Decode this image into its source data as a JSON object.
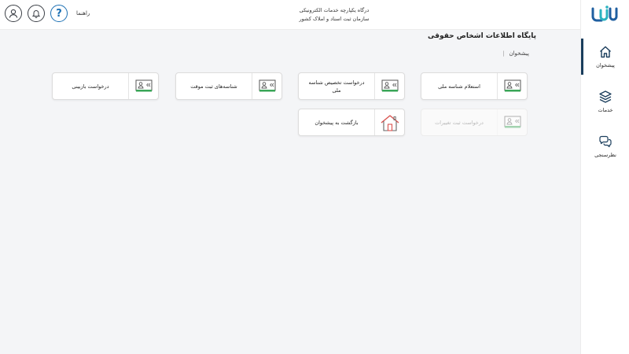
{
  "header": {
    "help_label": "راهنما",
    "help_glyph": "?",
    "gov_title_line1": "درگاه یکپارچه خدمات الکترونیکی",
    "gov_title_line2": "سازمان ثبت اسناد و املاک کشور"
  },
  "sidebar": {
    "items": [
      {
        "label": "پیشخوان",
        "icon": "home-icon",
        "active": true
      },
      {
        "label": "خدمات",
        "icon": "layers-icon",
        "active": false
      },
      {
        "label": "نظرسنجی",
        "icon": "chat-icon",
        "active": false
      }
    ]
  },
  "main": {
    "title": "پایگاه اطلاعات اشخاص حقوقی",
    "breadcrumb": {
      "current": "پیشخوان",
      "separator": "|"
    },
    "cards": [
      {
        "label": "استعلام شناسه ملی",
        "icon": "id-card-icon",
        "enabled": true
      },
      {
        "label": "درخواست تخصیص شناسه ملی",
        "icon": "id-card-icon",
        "enabled": true
      },
      {
        "label": "شناسه‌های ثبت موقت",
        "icon": "id-card-icon",
        "enabled": true
      },
      {
        "label": "درخواست بازبینی",
        "icon": "id-card-icon",
        "enabled": true
      },
      {
        "label": "درخواست ثبت تغییرات",
        "icon": "id-card-icon",
        "enabled": false
      },
      {
        "label": "بازگشت به پیشخوان",
        "icon": "house-icon",
        "enabled": true
      }
    ]
  },
  "colors": {
    "accent": "#1a6fb3",
    "sidebar_active": "#1a3d5c",
    "icon_green": "#3aa657",
    "house_red": "#d9534f"
  }
}
